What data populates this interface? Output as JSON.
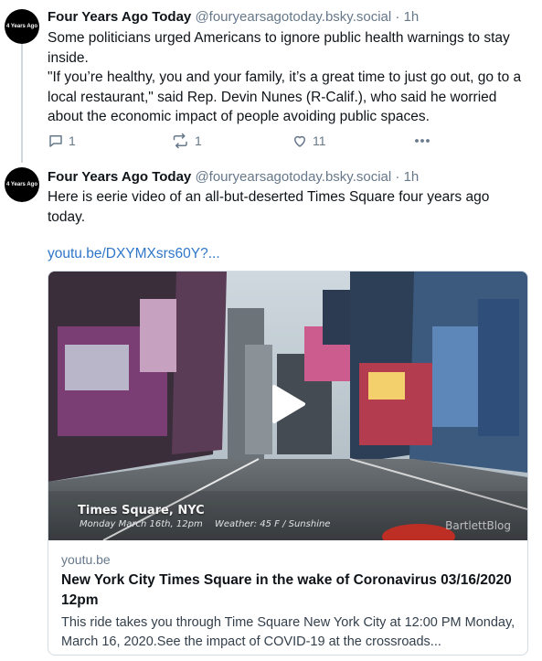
{
  "posts": [
    {
      "avatar_text": "4 Years Ago",
      "author": "Four Years Ago Today",
      "handle": "@fouryearsagotoday.bsky.social",
      "separator": "·",
      "time": "1h",
      "paragraphs": [
        "Some politicians urged Americans to ignore public health warnings to stay inside.",
        "\"If you’re healthy, you and your family, it’s a great time to just go out, go to a local restaurant,\" said Rep. Devin Nunes (R-Calif.), who said he worried about the economic impact of people avoiding public spaces."
      ],
      "actions": {
        "reply_count": "1",
        "repost_count": "1",
        "like_count": "11"
      }
    },
    {
      "avatar_text": "4 Years Ago",
      "author": "Four Years Ago Today",
      "handle": "@fouryearsagotoday.bsky.social",
      "separator": "·",
      "time": "1h",
      "text": "Here is eerie video of an all-but-deserted Times Square four years ago today.",
      "link": "youtu.be/DXYMXsrs60Y?...",
      "card": {
        "video_overlay_title": "Times Square, NYC",
        "video_overlay_date": "Monday March 16th, 12pm",
        "video_overlay_weather": "Weather: 45 F / Sunshine",
        "video_watermark": "BartlettBlog",
        "domain": "youtu.be",
        "title": "New York City Times Square in the wake of Coronavirus 03/16/2020 12pm",
        "description": "This ride takes you through Time Square New York City at 12:00 PM Monday, March 16, 2020.See the impact of COVID-19 at the crossroads..."
      }
    }
  ],
  "colors": {
    "accent_link": "#2f76c9",
    "muted": "#66788a",
    "text": "#0f1419",
    "avatar_bg": "#000000"
  },
  "icons": [
    "reply-icon",
    "repost-icon",
    "like-icon",
    "more-icon",
    "play-icon"
  ]
}
